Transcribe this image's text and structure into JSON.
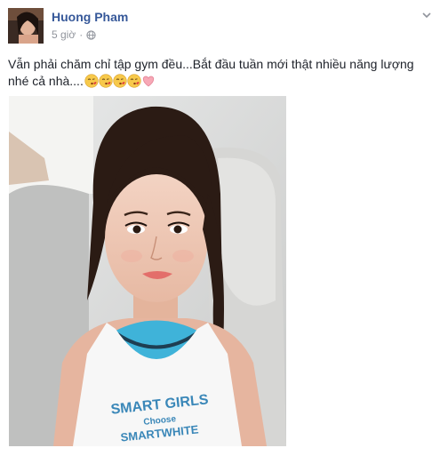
{
  "post": {
    "author": "Huong Pham",
    "time": "5 giờ",
    "separator": "·",
    "message": "Vẫn phải chăm chỉ tập gym đều...Bắt đầu tuần mới thật nhiều năng lượng nhé cả nhà....",
    "emojis": [
      "kiss-face-icon",
      "kiss-face-icon",
      "kiss-face-icon",
      "kiss-face-icon",
      "pink-heart-icon"
    ],
    "audience_icon": "globe-icon",
    "menu_icon": "chevron-down-icon",
    "photo": {
      "shirt_text_line1": "SMART GIRLS",
      "shirt_text_line2": "Choose",
      "shirt_text_line3": "SMARTWHITE"
    }
  },
  "colors": {
    "author_link": "#365899",
    "meta_text": "#90949c",
    "body_text": "#1d2129",
    "tank_top_blue": "#3fb3d9"
  }
}
